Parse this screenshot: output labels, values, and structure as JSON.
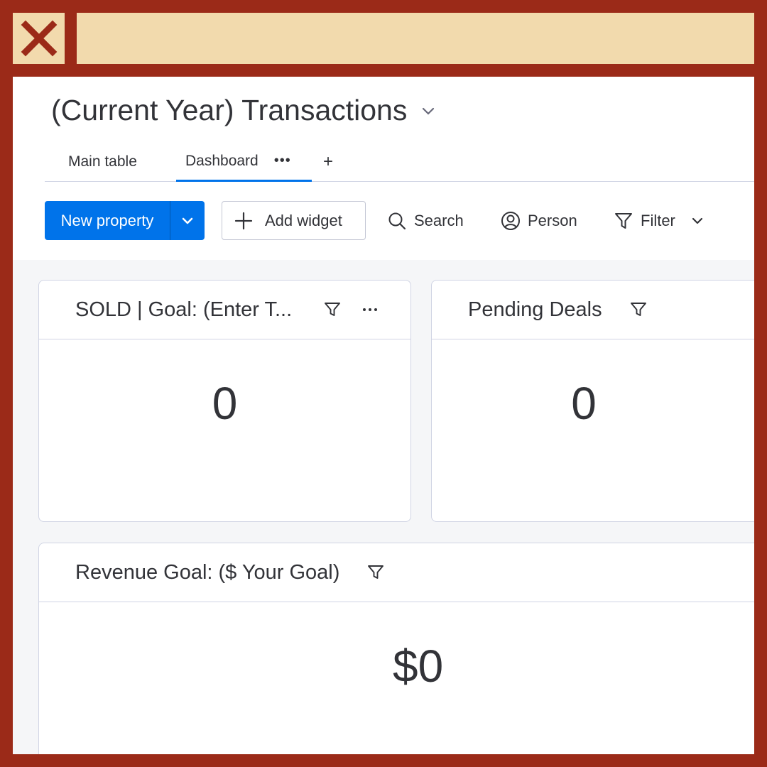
{
  "board": {
    "title": "(Current Year) Transactions"
  },
  "tabs": {
    "main": "Main table",
    "dashboard": "Dashboard",
    "dashboard_more": "•••",
    "add": "+"
  },
  "toolbar": {
    "new_property": "New property",
    "add_widget": "Add widget",
    "search": "Search",
    "person": "Person",
    "filter": "Filter"
  },
  "widgets": {
    "sold": {
      "title": "SOLD | Goal: (Enter T...",
      "value": "0"
    },
    "pending": {
      "title": "Pending Deals",
      "value": "0"
    },
    "revenue": {
      "title": "Revenue Goal: ($ Your Goal)",
      "value": "$0"
    }
  },
  "colors": {
    "frame": "#9b2a18",
    "banner": "#f2daad",
    "primary": "#0073ea"
  }
}
